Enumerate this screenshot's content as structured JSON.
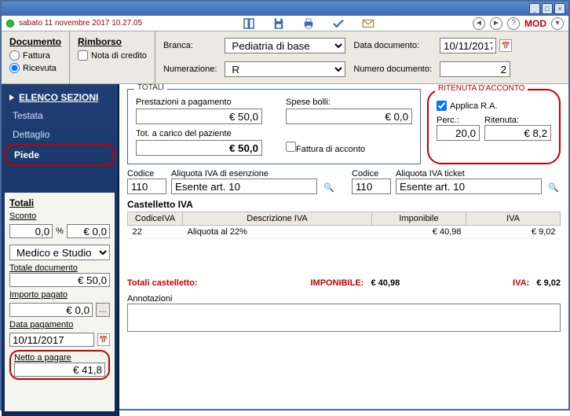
{
  "titlebar": {
    "min": "_",
    "max": "□",
    "close": "×"
  },
  "status": {
    "datetime": "sabato 11 novembre 2017   10.27.05",
    "nav_back": "◄",
    "nav_fwd": "►",
    "help": "?",
    "mod": "MOD"
  },
  "doc_panel": {
    "title": "Documento",
    "fattura": "Fattura",
    "ricevuta": "Ricevuta"
  },
  "rimborso": {
    "title": "Rimborso",
    "nota": "Nota di credito"
  },
  "topform": {
    "branca_lbl": "Branca:",
    "branca_val": "Pediatria di base",
    "data_lbl": "Data documento:",
    "data_val": "10/11/2017",
    "num_lbl": "Numerazione:",
    "num_val": "R",
    "numdoc_lbl": "Numero documento:",
    "numdoc_val": "2"
  },
  "sidebar": {
    "head": "ELENCO SEZIONI",
    "items": [
      "Testata",
      "Dettaglio",
      "Piede"
    ]
  },
  "totals_side": {
    "head": "Totali",
    "sconto_lbl": "Sconto",
    "sconto_val": "0,0",
    "pct": "%",
    "sconto_eur": "€ 0,0",
    "combo": "Medico e Studio",
    "totdoc_lbl": "Totale documento",
    "totdoc_val": "€ 50,0",
    "imp_lbl": "Importo pagato",
    "imp_val": "€ 0,0",
    "datapag_lbl": "Data pagamento",
    "datapag_val": "10/11/2017",
    "netto_lbl": "Netto a pagare",
    "netto_val": "€ 41,8"
  },
  "totali": {
    "label": "TOTALI",
    "prest_lbl": "Prestazioni a pagamento",
    "prest_val": "€ 50,0",
    "spese_lbl": "Spese bolli:",
    "spese_val": "€ 0,0",
    "totcar_lbl": "Tot. a carico del paziente",
    "totcar_val": "€ 50,0",
    "fatt_acc": "Fattura di acconto"
  },
  "ritenuta": {
    "label": "RITENUTA D'ACCONTO",
    "applica": "Applica R.A.",
    "perc_lbl": "Perc.:",
    "perc_val": "20,0",
    "rit_lbl": "Ritenuta:",
    "rit_val": "€ 8,2"
  },
  "codes": {
    "codice_lbl": "Codice",
    "aliq_esen_lbl": "Aliquota IVA di esenzione",
    "cod1": "110",
    "esen1": "Esente art. 10",
    "aliq_tkt_lbl": "Aliquota IVA ticket",
    "cod2": "110",
    "esen2": "Esente art. 10"
  },
  "castelletto": {
    "title": "Castelletto IVA",
    "h1": "CodiceIVA",
    "h2": "Descrizione IVA",
    "h3": "Imponibile",
    "h4": "IVA",
    "row": {
      "c": "22",
      "d": "Aliquota al 22%",
      "imp": "€ 40,98",
      "iva": "€ 9,02"
    },
    "tot_lbl": "Totali castelletto:",
    "imp_lbl": "IMPONIBILE:",
    "imp_val": "€ 40,98",
    "iva_lbl": "IVA:",
    "iva_val": "€ 9,02"
  },
  "annot_lbl": "Annotazioni"
}
